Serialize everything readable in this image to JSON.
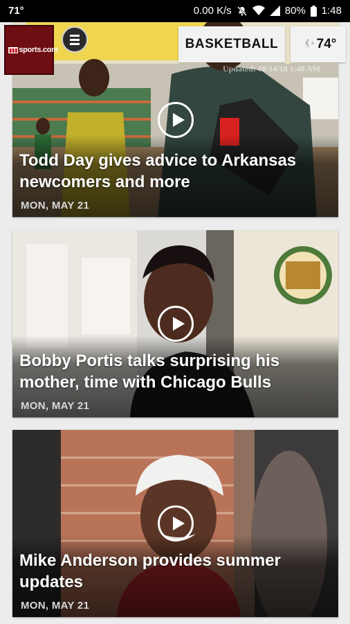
{
  "status_bar": {
    "temp": "71°",
    "speed": "0.00 K/s",
    "battery": "80%",
    "time": "1:48",
    "icons": [
      "mute-icon",
      "wifi-icon",
      "signal-icon",
      "battery-icon"
    ]
  },
  "header": {
    "logo_text": "sports.com",
    "section": "BASKETBALL",
    "weather_temp": "74°",
    "weather_icon": "plane-icon",
    "updated": "Updated: 08/14/18 1:48 AM"
  },
  "articles": [
    {
      "headline": "Todd Day gives advice to Arkansas newcomers and more",
      "date": "MON, MAY 21"
    },
    {
      "headline": "Bobby Portis talks surprising his mother, time with Chicago Bulls",
      "date": "MON, MAY 21"
    },
    {
      "headline": "Mike Anderson provides summer updates",
      "date": "MON, MAY 21"
    }
  ],
  "colors": {
    "brand": "#6e0d12",
    "status_bar": "#000000",
    "card_text": "#ffffff"
  }
}
